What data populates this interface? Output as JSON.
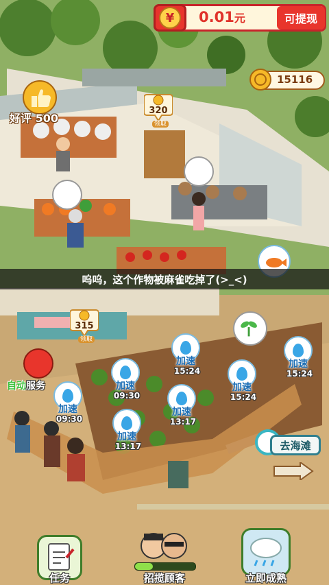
{
  "hud": {
    "currency_symbol": "¥",
    "cash_amount": "0.01",
    "cash_unit": "元",
    "withdraw_label": "可提现",
    "coin_balance": "15116",
    "rating_label": "好评 500"
  },
  "shop_collect": [
    {
      "amount": "320",
      "tag": "领取"
    },
    {
      "amount": "315",
      "tag": "领取"
    }
  ],
  "toast": "呜呜，这个作物被麻雀吃掉了(>_<)",
  "farm_plots": [
    {
      "label": "加速",
      "timer": "15:24"
    },
    {
      "label": "加速",
      "timer": "15:24"
    },
    {
      "label": "加速",
      "timer": "15:24"
    },
    {
      "label": "加速",
      "timer": "09:30"
    },
    {
      "label": "加速",
      "timer": "09:30"
    },
    {
      "label": "加速",
      "timer": "13:17"
    },
    {
      "label": "加速",
      "timer": "13:17"
    }
  ],
  "auto_service": {
    "part_a": "自动",
    "part_b": "服务"
  },
  "beach_sign": "去海滩",
  "bottom_nav": {
    "tasks": "任务",
    "recruit": "招揽顾客",
    "recruit_progress": 0.3,
    "ripen": "立即成熟"
  },
  "colors": {
    "accent_red": "#e8352c",
    "coin_gold": "#f6b928",
    "speed_blue": "#1d6fb6"
  }
}
